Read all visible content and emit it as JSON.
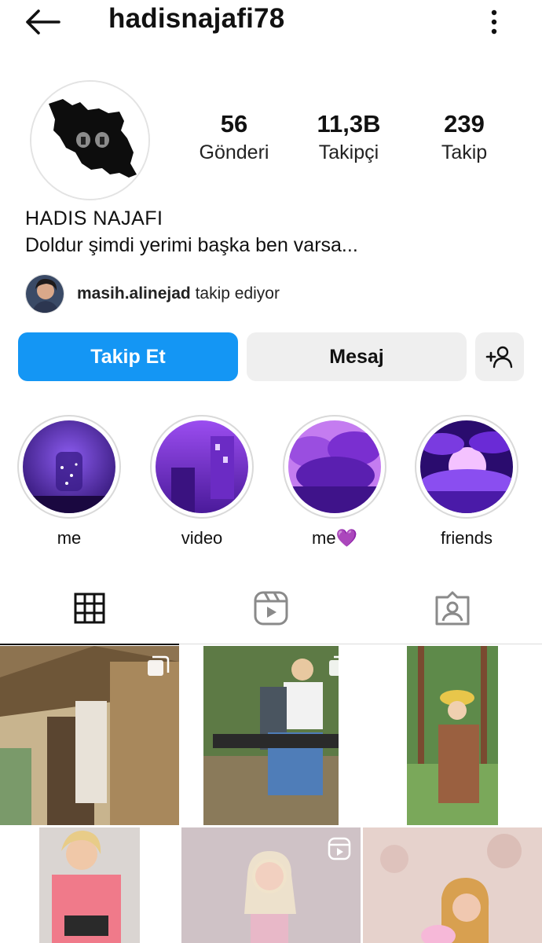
{
  "header": {
    "username": "hadisnajafi78",
    "back_icon": "arrow-left-icon",
    "menu_icon": "more-vertical-icon"
  },
  "profile": {
    "display_name": "HADIS NAJAFI",
    "bio": "Doldur şimdi yerimi başka ben varsa...",
    "stats": [
      {
        "value": "56",
        "label": "Gönderi"
      },
      {
        "value": "11,3B",
        "label": "Takipçi"
      },
      {
        "value": "239",
        "label": "Takip"
      }
    ],
    "followed_by": {
      "username": "masih.alinejad",
      "suffix": "takip ediyor"
    }
  },
  "actions": {
    "follow_label": "Takip Et",
    "message_label": "Mesaj",
    "suggest_icon": "add-person-icon"
  },
  "highlights": [
    {
      "label": "me"
    },
    {
      "label": "video"
    },
    {
      "label": "me💜"
    },
    {
      "label": "friends"
    }
  ],
  "tabs": [
    {
      "icon": "grid-icon",
      "active": true
    },
    {
      "icon": "reels-icon",
      "active": false
    },
    {
      "icon": "tagged-icon",
      "active": false
    }
  ],
  "colors": {
    "accent": "#1496f4",
    "secondary_button": "#efefef",
    "highlight_purple": "#6a2bd6"
  }
}
